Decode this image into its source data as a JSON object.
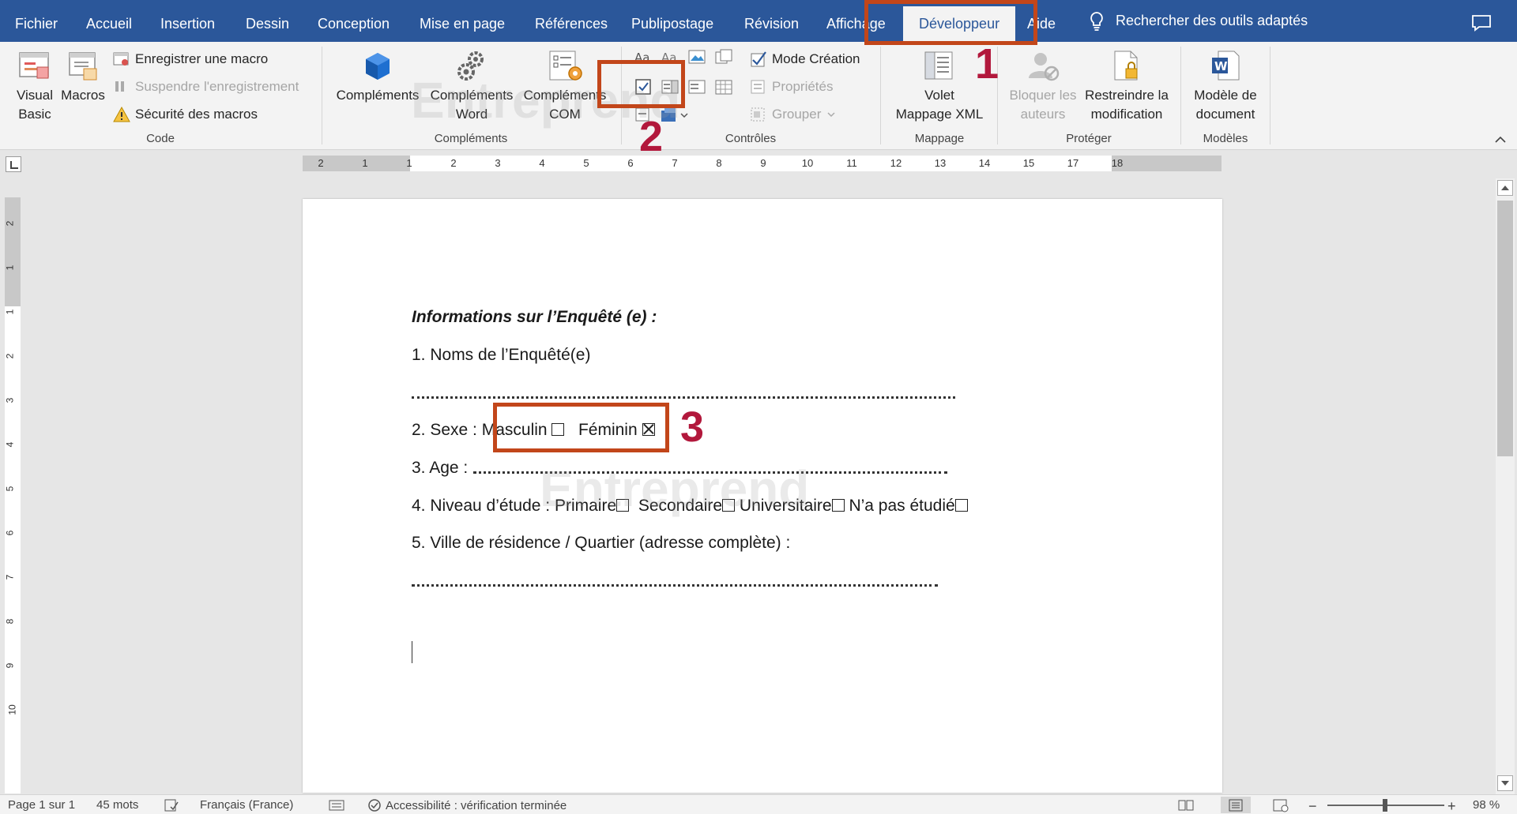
{
  "tabs": {
    "fichier": "Fichier",
    "accueil": "Accueil",
    "insertion": "Insertion",
    "dessin": "Dessin",
    "conception": "Conception",
    "mise_en_page": "Mise en page",
    "references": "Références",
    "publipostage": "Publipostage",
    "revision": "Révision",
    "affichage": "Affichage",
    "developpeur": "Développeur",
    "aide": "Aide"
  },
  "search": {
    "placeholder": "Rechercher des outils adaptés"
  },
  "ribbon": {
    "code": {
      "label": "Code",
      "visual_basic": "Visual\nBasic",
      "macros": "Macros",
      "enregistrer": "Enregistrer une macro",
      "suspendre": "Suspendre l'enregistrement",
      "securite": "Sécurité des macros"
    },
    "complements": {
      "label": "Compléments",
      "complements": "Compléments",
      "complements_word": "Compléments\nWord",
      "complements_com": "Compléments\nCOM"
    },
    "controles": {
      "label": "Contrôles",
      "mode_creation": "Mode Création",
      "proprietes": "Propriétés",
      "grouper": "Grouper"
    },
    "mappage": {
      "label": "Mappage",
      "volet": "Volet\nMappage XML"
    },
    "proteger": {
      "label": "Protéger",
      "bloquer": "Bloquer les\nauteurs",
      "restreindre": "Restreindre la\nmodification"
    },
    "modeles": {
      "label": "Modèles",
      "modele": "Modèle de\ndocument"
    }
  },
  "ruler": {
    "h_labels": [
      "2",
      "1",
      "1",
      "2",
      "3",
      "4",
      "5",
      "6",
      "7",
      "8",
      "9",
      "10",
      "11",
      "12",
      "13",
      "14",
      "15",
      "17",
      "18"
    ],
    "v_labels": [
      "2",
      "1",
      "1",
      "2",
      "3",
      "4",
      "5",
      "6",
      "7",
      "8",
      "9",
      "10"
    ]
  },
  "document": {
    "title": "Informations sur l’Enquêté (e) :",
    "q1": "1. Noms de l’Enquêté(e)",
    "q2_prefix": "2. Sexe : Masculin",
    "q2_feminin": "Féminin",
    "q3": "3. Age :",
    "q4_prefix": "4. Niveau d’étude : Primaire",
    "q4_secondaire": "Secondaire",
    "q4_universitaire": "Universitaire",
    "q4_aucun": "N’a pas étudié",
    "q5": "5. Ville de résidence / Quartier (adresse complète) :",
    "checkboxes": {
      "masculin": false,
      "feminin": true,
      "primaire": false,
      "secondaire": false,
      "universitaire": false,
      "aucun": false
    }
  },
  "watermark": "Entreprend",
  "annotations": {
    "one": "1",
    "two": "2",
    "three": "3"
  },
  "status": {
    "page": "Page 1 sur 1",
    "words": "45 mots",
    "language": "Français (France)",
    "accessibility": "Accessibilité : vérification terminée",
    "zoom": "98 %",
    "zoom_level": 0.49
  },
  "colors": {
    "brand": "#2b579a",
    "annotation_box": "#c2461a",
    "annotation_number": "#b2183c"
  }
}
